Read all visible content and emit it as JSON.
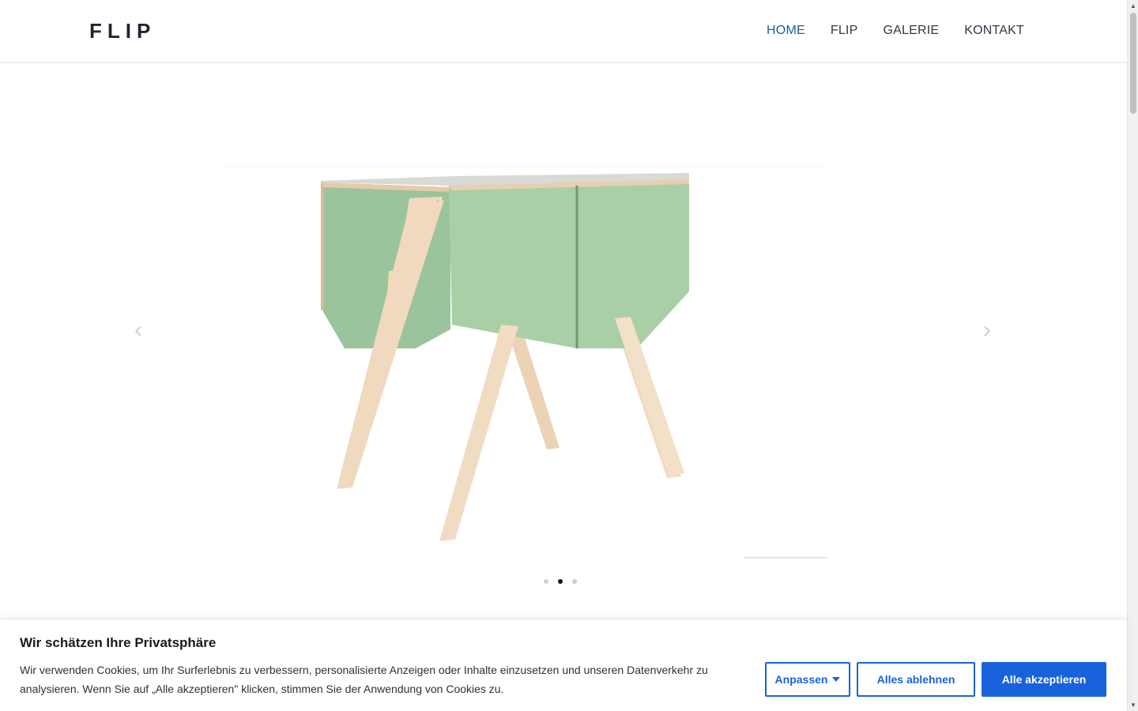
{
  "header": {
    "logo": "FLIP",
    "nav": [
      {
        "label": "HOME",
        "active": true
      },
      {
        "label": "FLIP",
        "active": false
      },
      {
        "label": "GALERIE",
        "active": false
      },
      {
        "label": "KONTAKT",
        "active": false
      }
    ]
  },
  "slider": {
    "prev_icon": "chevron-left-icon",
    "next_icon": "chevron-right-icon",
    "dots": 3,
    "active_dot": 2
  },
  "cookie": {
    "title": "Wir schätzen Ihre Privatsphäre",
    "text": "Wir verwenden Cookies, um Ihr Surferlebnis zu verbessern, personalisierte Anzeigen oder Inhalte einzusetzen und unseren Datenverkehr zu analysieren. Wenn Sie auf „Alle akzeptieren\" klicken, stimmen Sie der Anwendung von Cookies zu.",
    "customize_label": "Anpassen",
    "reject_label": "Alles ablehnen",
    "accept_label": "Alle akzeptieren"
  },
  "colors": {
    "accent": "#1863dc",
    "nav_active": "#1a5d97",
    "panel_green": "#a9cfa6",
    "wood": "#f0d9bf"
  }
}
